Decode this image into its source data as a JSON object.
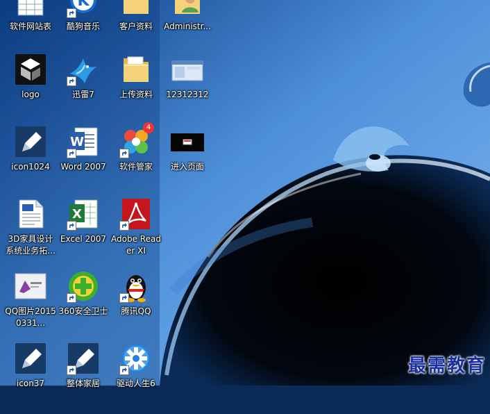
{
  "icons": [
    {
      "label": "软件网站表",
      "icon": "table-icon",
      "shortcut": false
    },
    {
      "label": "酷狗音乐",
      "icon": "kugou-music-icon",
      "shortcut": true
    },
    {
      "label": "客户资料",
      "icon": "folder-icon",
      "shortcut": false
    },
    {
      "label": "Administr...",
      "icon": "user-folder-icon",
      "shortcut": false
    },
    {
      "label": "logo",
      "icon": "logo-image-icon",
      "shortcut": false
    },
    {
      "label": "迅雷7",
      "icon": "thunder-bird-icon",
      "shortcut": true
    },
    {
      "label": "上传资料",
      "icon": "folder-icon",
      "shortcut": false
    },
    {
      "label": "12312312",
      "icon": "window-screenshot-icon",
      "shortcut": false
    },
    {
      "label": "icon1024",
      "icon": "pen-app-icon",
      "shortcut": false
    },
    {
      "label": "Word 2007",
      "icon": "word-icon",
      "shortcut": true
    },
    {
      "label": "软件管家",
      "icon": "software-manager-icon",
      "shortcut": true,
      "badge": "4"
    },
    {
      "label": "进入页面",
      "icon": "dark-page-icon",
      "shortcut": false
    },
    {
      "label": "3D家具设计系统业务拓...",
      "icon": "document-icon",
      "shortcut": false
    },
    {
      "label": "Excel 2007",
      "icon": "excel-icon",
      "shortcut": true
    },
    {
      "label": "Adobe Reader XI",
      "icon": "adobe-reader-icon",
      "shortcut": true
    },
    {
      "label": "QQ图片20150331...",
      "icon": "image-file-icon",
      "shortcut": false
    },
    {
      "label": "360安全卫士",
      "icon": "360-security-icon",
      "shortcut": true
    },
    {
      "label": "腾讯QQ",
      "icon": "qq-penguin-icon",
      "shortcut": true
    },
    {
      "label": "icon37",
      "icon": "pen-app-icon",
      "shortcut": false
    },
    {
      "label": "整体家居",
      "icon": "pen-app-icon",
      "shortcut": true
    },
    {
      "label": "驱动人生6",
      "icon": "gear-icon",
      "shortcut": true
    }
  ],
  "watermark": "最需教育",
  "colors": {
    "wallpaper_light": "#5f9be0",
    "wallpaper_dark": "#02060f",
    "watermark": "#1a2fa0"
  }
}
